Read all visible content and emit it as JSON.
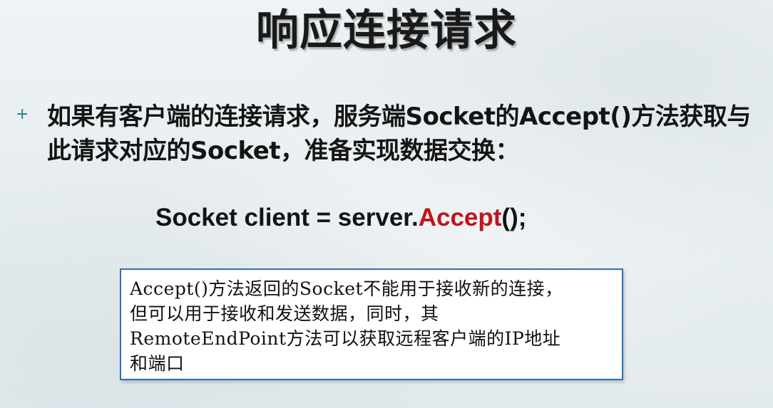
{
  "slide": {
    "title": "响应连接请求",
    "bullet": {
      "icon": "plus-icon",
      "icon_glyph": "+",
      "text": "如果有客户端的连接请求，服务端Socket的Accept()方法获取与此请求对应的Socket，准备实现数据交换："
    },
    "code": {
      "prefix": "Socket client = server.",
      "highlight": "Accept",
      "suffix": "();",
      "highlight_color": "#c0141c"
    },
    "note": {
      "lines": [
        "Accept()方法返回的Socket不能用于接收新的连接，",
        "但可以用于接收和发送数据，同时，其",
        "RemoteEndPoint方法可以获取远程客户端的IP地址",
        "和端口"
      ],
      "border_color": "#2f6fb7"
    }
  }
}
